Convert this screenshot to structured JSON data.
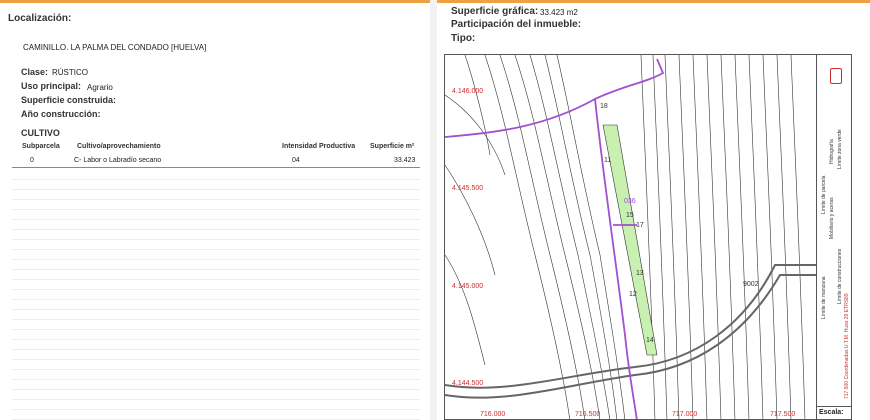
{
  "left": {
    "localizacion_label": "Localización:",
    "address": "CAMINILLO. LA PALMA DEL CONDADO [HUELVA]",
    "clase_label": "Clase:",
    "clase_value": "RÚSTICO",
    "uso_label": "Uso principal:",
    "uso_value": "Agrario",
    "sup_construida_label": "Superficie construida:",
    "anio_label": "Año construcción:",
    "cultivo_label": "CULTIVO",
    "table": {
      "headers": [
        "Subparcela",
        "Cultivo/aprovechamiento",
        "Intensidad Productiva",
        "Superficie m²"
      ],
      "rows": [
        {
          "subparcela": "0",
          "cultivo": "C- Labor o Labradío secano",
          "intensidad": "04",
          "superficie": "33.423"
        }
      ]
    }
  },
  "right": {
    "sup_grafica_label": "Superficie gráfica:",
    "sup_grafica_value": "33.423 m2",
    "participacion_label": "Participación del inmueble:",
    "tipo_label": "Tipo:",
    "map": {
      "y_coords": [
        "4.146.000",
        "4.145.500",
        "4.145.000",
        "4.144.500"
      ],
      "x_coords": [
        "716.000",
        "716.500",
        "717.000",
        "717.500"
      ],
      "parcel_labels": [
        "18",
        "11",
        "15",
        "17",
        "13",
        "12",
        "14",
        "9002",
        "036"
      ],
      "legend": [
        "Límite de parcela",
        "Límite de manzana",
        "Hidrografía",
        "Mobiliario y aceras",
        "Límite zona verde",
        "Límite de construcciones"
      ],
      "crs_note": "717.500 Coordenadas U.T.M. Huso 29 ETRS89",
      "scale_label": "Escala:"
    },
    "colors": {
      "accent": "#f0a040",
      "coords": "#c83030",
      "parcel": "#a050d0",
      "green": "#c8f0b0"
    }
  }
}
